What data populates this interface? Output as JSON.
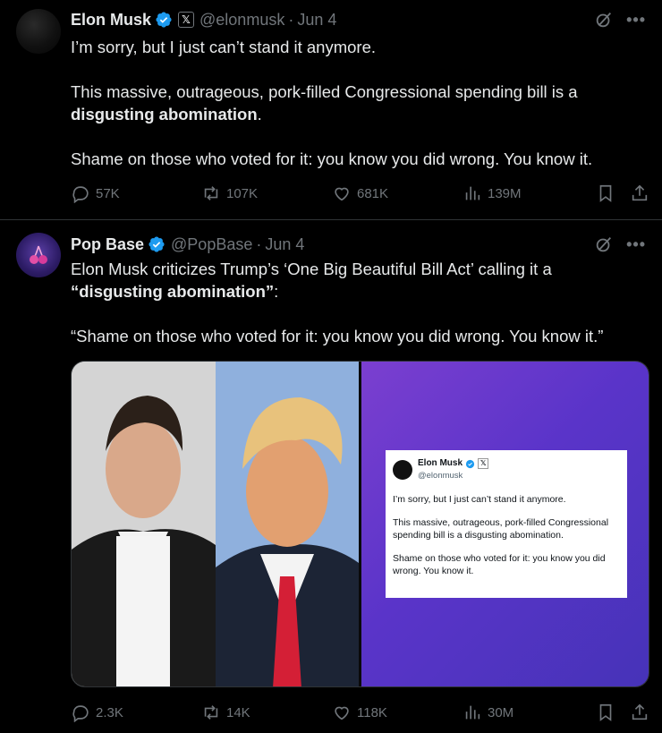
{
  "tweets": [
    {
      "name": "Elon Musk",
      "handle": "@elonmusk",
      "date": "Jun 4",
      "badge_x": "𝕏",
      "paragraphs": [
        "I’m sorry, but I just can’t stand it anymore.",
        "This massive, outrageous, pork-filled Congressional spending bill is a ",
        "disgusting abomination",
        ".",
        "Shame on those who voted for it: you know you did wrong. You know it."
      ],
      "stats": {
        "replies": "57K",
        "reposts": "107K",
        "likes": "681K",
        "views": "139M"
      }
    },
    {
      "name": "Pop Base",
      "handle": "@PopBase",
      "date": "Jun 4",
      "paragraphs": [
        "Elon Musk criticizes Trump’s ‘One Big Beautiful Bill Act’ calling it a ",
        "“disgusting abomination”",
        ":",
        "“Shame on those who voted for it: you know you did wrong. You know it.”"
      ],
      "embedded_card": {
        "name": "Elon Musk",
        "handle": "@elonmusk",
        "badge_x": "𝕏",
        "lines": [
          "I’m sorry, but I just can’t stand it anymore.",
          "This massive, outrageous, pork-filled Congressional spending bill is a disgusting abomination.",
          "Shame on those who voted for it: you know you did wrong. You know it."
        ]
      },
      "stats": {
        "replies": "2.3K",
        "reposts": "14K",
        "likes": "118K",
        "views": "30M"
      }
    }
  ],
  "separator": "·",
  "colors": {
    "background": "#000000",
    "text": "#e7e9ea",
    "muted": "#71767b",
    "verified": "#1d9bf0",
    "border": "#2f3336"
  }
}
